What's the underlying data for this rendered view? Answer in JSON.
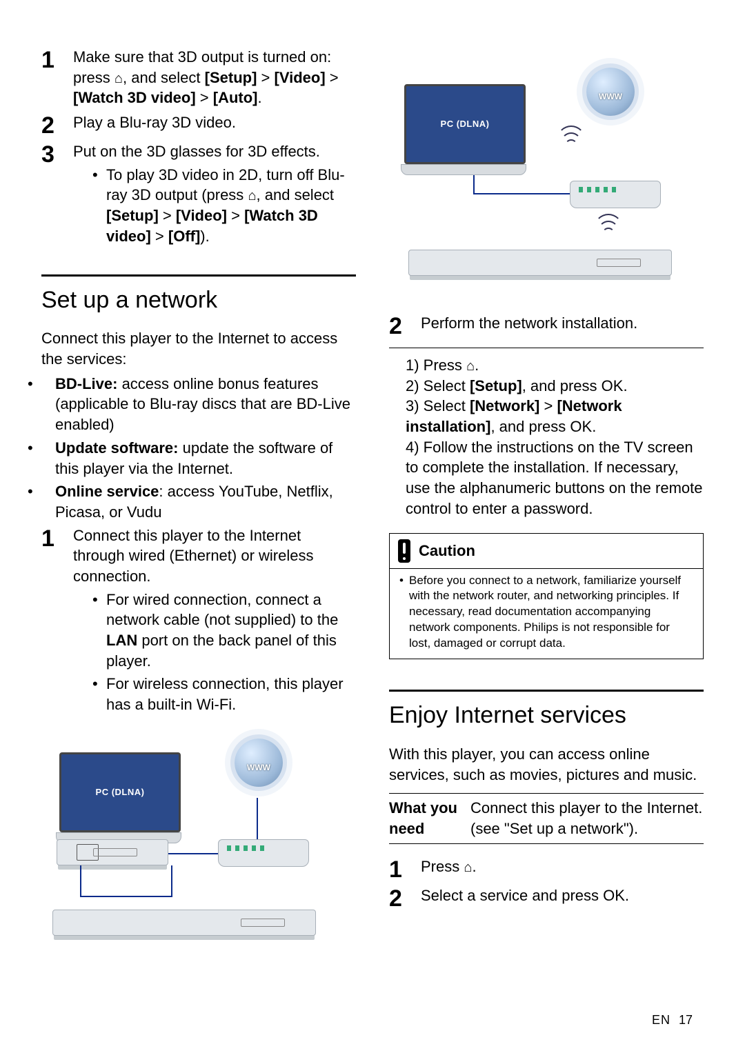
{
  "threeD": {
    "step1_a": "Make sure that 3D output is turned on: press ",
    "step1_b": ", and select ",
    "step1_setup": "[Setup]",
    "step1_gt1": " > ",
    "step1_video": "[Video]",
    "step1_c": " >",
    "step1_watch": "[Watch 3D video]",
    "step1_gt2": " > ",
    "step1_auto": "[Auto]",
    "step1_end": ".",
    "step2": "Play a Blu-ray 3D video.",
    "step3": "Put on the 3D glasses for 3D effects.",
    "sub_a1": "To play 3D video in 2D, turn off Blu-ray 3D output (press ",
    "sub_a2": ", and select ",
    "sub_setup": "[Setup]",
    "sub_gt1": " > ",
    "sub_video": "[Video]",
    "sub_gt2": " > ",
    "sub_watch": "[Watch 3D video]",
    "sub_gt3": " > ",
    "sub_off": "[Off]",
    "sub_end": ")."
  },
  "network": {
    "heading": "Set up a network",
    "intro": "Connect this player to the Internet to access the services:",
    "b1_bold": "BD-Live:",
    "b1_rest": " access online bonus features (applicable to Blu-ray discs that are BD-Live enabled)",
    "b2_bold": "Update software:",
    "b2_rest": " update the software of this player via the Internet.",
    "b3_bold": "Online service",
    "b3_rest": ": access YouTube, Netflix, Picasa, or Vudu",
    "s1": "Connect this player to the Internet through wired (Ethernet) or wireless connection.",
    "s1a_pre": "For wired connection, connect a network cable (not supplied) to the ",
    "s1a_bold": "LAN",
    "s1a_post": " port on the back panel of this player.",
    "s1b": "For wireless connection, this player has a built-in Wi-Fi.",
    "fig_pc_label": "PC (DLNA)",
    "fig_www": "WWW",
    "s2": "Perform the network installation.",
    "inst1_pre": "1) Press ",
    "inst1_post": ".",
    "inst2_pre": "2) Select ",
    "inst2_bold": "[Setup]",
    "inst2_post": ", and press OK.",
    "inst3_pre": "3) Select ",
    "inst3_b1": "[Network]",
    "inst3_mid": " > ",
    "inst3_b2": "[Network installation]",
    "inst3_post": ", and press OK.",
    "inst4": "4) Follow the instructions on the TV screen to complete the installation. If necessary, use the alphanumeric buttons on the remote control to enter a password."
  },
  "caution": {
    "title": "Caution",
    "body": "Before you connect to a network, familiarize yourself with the network router, and networking principles. If necessary, read documentation accompanying network components. Philips is not responsible for lost, damaged or corrupt data."
  },
  "enjoy": {
    "heading": "Enjoy Internet services",
    "intro": "With this player, you can access online services, such as movies, pictures and music.",
    "need_left": "What you need",
    "need_right": "Connect this player to the Internet. (see \"Set up a network\").",
    "s1_pre": "Press ",
    "s1_post": ".",
    "s2": "Select a service and press OK."
  },
  "footer": {
    "lang": "EN",
    "page": "17"
  }
}
